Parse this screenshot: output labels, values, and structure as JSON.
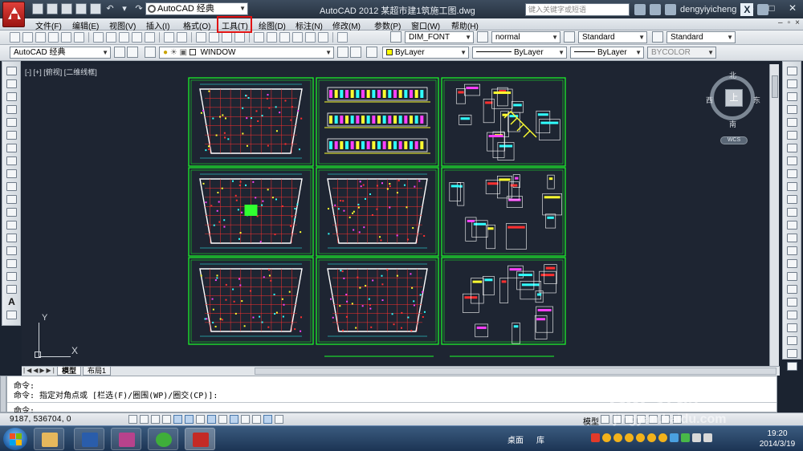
{
  "titlebar": {
    "workspace": "AutoCAD 经典",
    "title": "AutoCAD 2012    某超市建1筑施工图.dwg",
    "search_placeholder": "键入关键字或短语",
    "username": "dengyiyicheng",
    "minimize": "–",
    "restore": "□",
    "close": "✕"
  },
  "menu": {
    "items": [
      "文件(F)",
      "编辑(E)",
      "视图(V)",
      "插入(I)",
      "格式(O)",
      "工具(T)",
      "绘图(D)",
      "标注(N)",
      "修改(M)",
      "参数(P)",
      "窗口(W)",
      "帮助(H)"
    ],
    "highlighted": "工具(T)"
  },
  "toolbar1": {
    "text_style": "DIM_FONT",
    "dim_style": "normal",
    "table_style": "Standard",
    "mleader_style": "Standard"
  },
  "toolbar2": {
    "workspace": "AutoCAD 经典",
    "layer": "WINDOW",
    "color": "ByLayer",
    "linetype": "ByLayer",
    "lineweight": "ByLayer",
    "plotstyle": "BYCOLOR"
  },
  "canvas": {
    "view_label": "[-] [+] [俯视] [二维线框]",
    "viewcube": {
      "north": "北",
      "south": "南",
      "east": "东",
      "west": "西",
      "top": "上",
      "wcs": "WCS"
    },
    "ucs_x": "X",
    "ucs_y": "Y"
  },
  "tabs": {
    "model": "模型",
    "layout1": "布局1"
  },
  "command": {
    "line1": "命令:",
    "line2": "命令: 指定对角点或 [栏选(F)/圈围(WP)/圈交(CP)]:",
    "prompt": "命令:"
  },
  "status": {
    "coords": "9187,   536704,  0",
    "model": "模型"
  },
  "taskbar": {
    "desktop": "桌面",
    "library": "库",
    "time": "19:20",
    "date": "2014/3/19"
  },
  "watermark": {
    "brand": "Bai 经验",
    "url": "jingyan.baidu.com"
  },
  "colors": {
    "canvas_bg": "#1e2532",
    "sheet_border": "#1aff2a",
    "highlight": "#e01010"
  }
}
